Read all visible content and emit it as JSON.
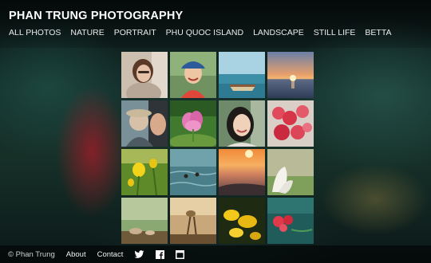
{
  "site": {
    "title": "PHAN TRUNG PHOTOGRAPHY"
  },
  "nav": {
    "items": [
      {
        "label": "ALL PHOTOS"
      },
      {
        "label": "NATURE"
      },
      {
        "label": "PORTRAIT"
      },
      {
        "label": "PHU QUOC ISLAND"
      },
      {
        "label": "LANDSCAPE"
      },
      {
        "label": "STILL LIFE"
      },
      {
        "label": "BETTA"
      }
    ]
  },
  "gallery": {
    "photos": [
      {
        "subject": "portrait-girl-glasses"
      },
      {
        "subject": "portrait-girl-cap"
      },
      {
        "subject": "boat-on-sea"
      },
      {
        "subject": "sunset-over-sea"
      },
      {
        "subject": "girl-with-hat"
      },
      {
        "subject": "pink-flower"
      },
      {
        "subject": "portrait-girl-smiling"
      },
      {
        "subject": "red-flowers"
      },
      {
        "subject": "yellow-flowers"
      },
      {
        "subject": "swimmers-in-water"
      },
      {
        "subject": "beach-sunset"
      },
      {
        "subject": "white-flower"
      },
      {
        "subject": "mushrooms-on-ground"
      },
      {
        "subject": "backlit-plant"
      },
      {
        "subject": "yellow-blossoms"
      },
      {
        "subject": "red-flower-teal"
      }
    ]
  },
  "footer": {
    "copyright": "© Phan Trung",
    "about": "About",
    "contact": "Contact",
    "icons": [
      "twitter-icon",
      "facebook-icon",
      "square-icon"
    ]
  }
}
